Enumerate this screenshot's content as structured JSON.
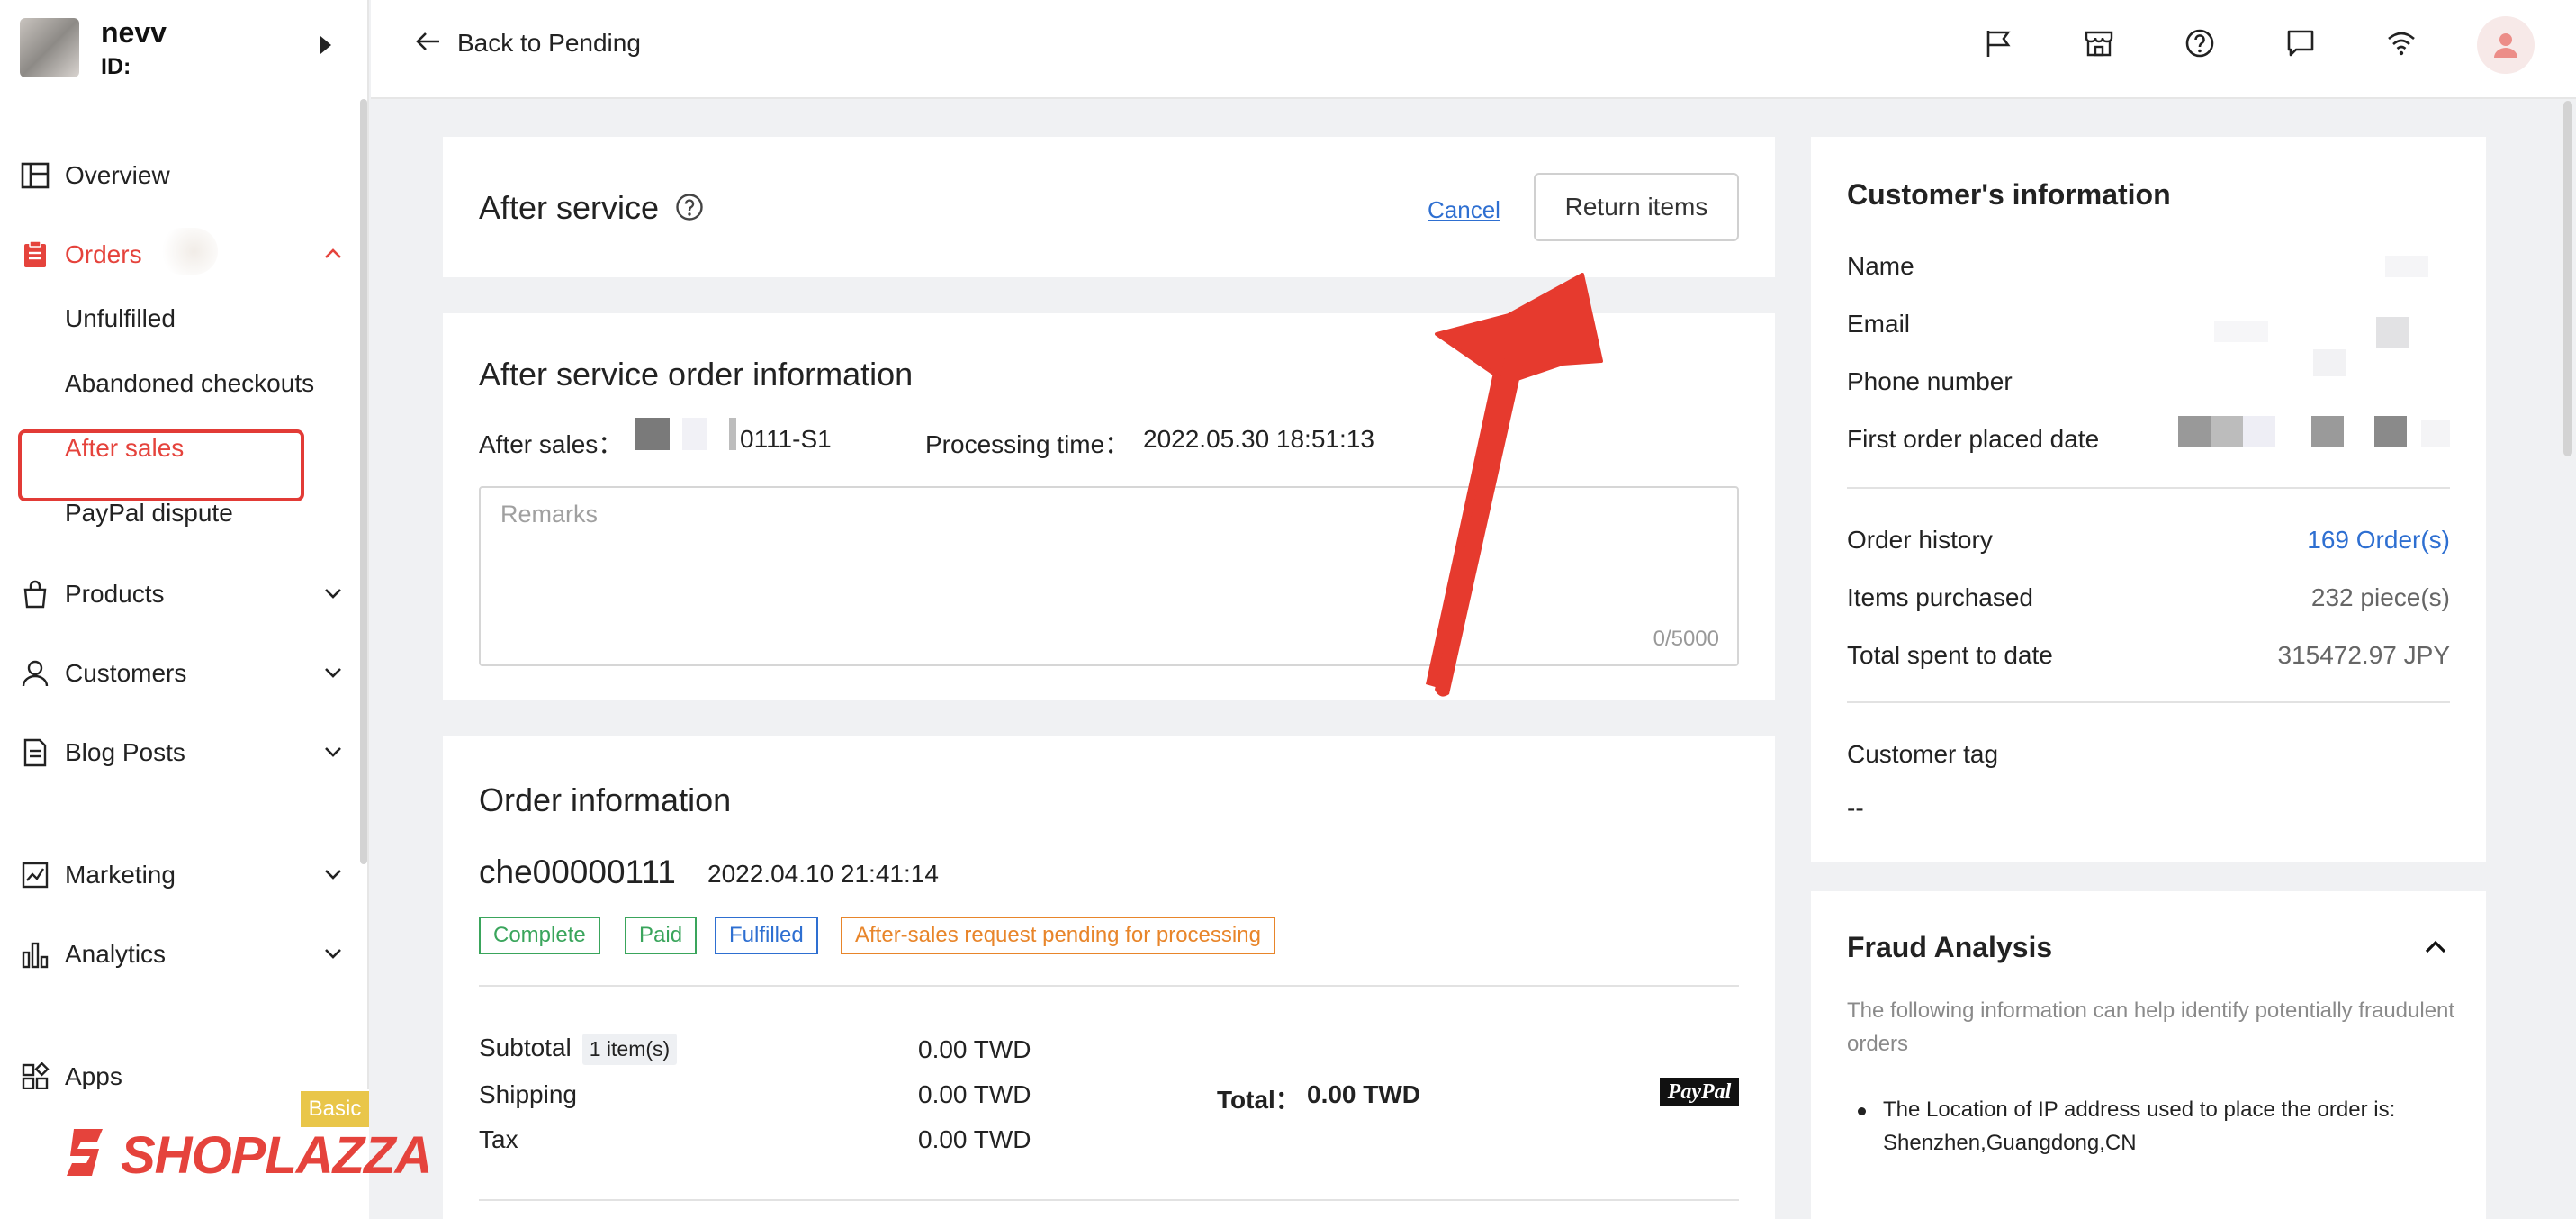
{
  "user": {
    "name": "nevv",
    "id_label": "ID:"
  },
  "sidebar": {
    "items": [
      {
        "label": "Overview",
        "icon": "overview-icon"
      },
      {
        "label": "Orders",
        "icon": "orders-icon"
      },
      {
        "label": "Products",
        "icon": "products-icon"
      },
      {
        "label": "Customers",
        "icon": "customers-icon"
      },
      {
        "label": "Blog Posts",
        "icon": "blog-icon"
      },
      {
        "label": "Marketing",
        "icon": "marketing-icon"
      },
      {
        "label": "Analytics",
        "icon": "analytics-icon"
      },
      {
        "label": "Apps",
        "icon": "apps-icon"
      }
    ],
    "orders_sub": [
      "Unfulfilled",
      "Abandoned checkouts",
      "After sales",
      "PayPal dispute"
    ],
    "active_color": "#e5433c",
    "plan_badge": "Basic",
    "brand": "SHOPLAZZA"
  },
  "topbar": {
    "back_label": "Back to Pending",
    "icons": [
      "flag-icon",
      "store-icon",
      "help-icon",
      "chat-icon",
      "wifi-icon",
      "profile-icon"
    ]
  },
  "after_service": {
    "title": "After service",
    "cancel_label": "Cancel",
    "return_button": "Return items"
  },
  "service_info": {
    "title": "After service order information",
    "after_sales_label": "After sales：",
    "after_sales_value": "0111-S1",
    "processing_label": "Processing time：",
    "processing_value": "2022.05.30 18:51:13",
    "remarks_placeholder": "Remarks",
    "remarks_count": "0/5000"
  },
  "order": {
    "title": "Order information",
    "number": "che00000111",
    "date": "2022.04.10 21:41:14",
    "tags": [
      {
        "label": "Complete",
        "color": "#3aa55c"
      },
      {
        "label": "Paid",
        "color": "#3aa55c"
      },
      {
        "label": "Fulfilled",
        "color": "#2e6fd1"
      },
      {
        "label": "After-sales request pending for processing",
        "color": "#e8852a"
      }
    ],
    "subtotal_label": "Subtotal",
    "item_count": "1 item(s)",
    "subtotal_value": "0.00 TWD",
    "shipping_label": "Shipping",
    "shipping_value": "0.00 TWD",
    "tax_label": "Tax",
    "tax_value": "0.00 TWD",
    "total_label": "Total：",
    "total_value": "0.00 TWD",
    "payment_method": "PayPal"
  },
  "customer": {
    "title": "Customer's information",
    "fields": [
      "Name",
      "Email",
      "Phone number",
      "First order placed date"
    ],
    "history_label": "Order history",
    "history_value": "169 Order(s)",
    "items_label": "Items purchased",
    "items_value": "232 piece(s)",
    "spent_label": "Total spent to date",
    "spent_value": "315472.97 JPY",
    "tag_label": "Customer tag",
    "tag_value": "--"
  },
  "fraud": {
    "title": "Fraud Analysis",
    "description": "The following information can help identify potentially fraudulent orders",
    "bullet": "The Location of IP address used to place the order is: Shenzhen,Guangdong,CN"
  }
}
